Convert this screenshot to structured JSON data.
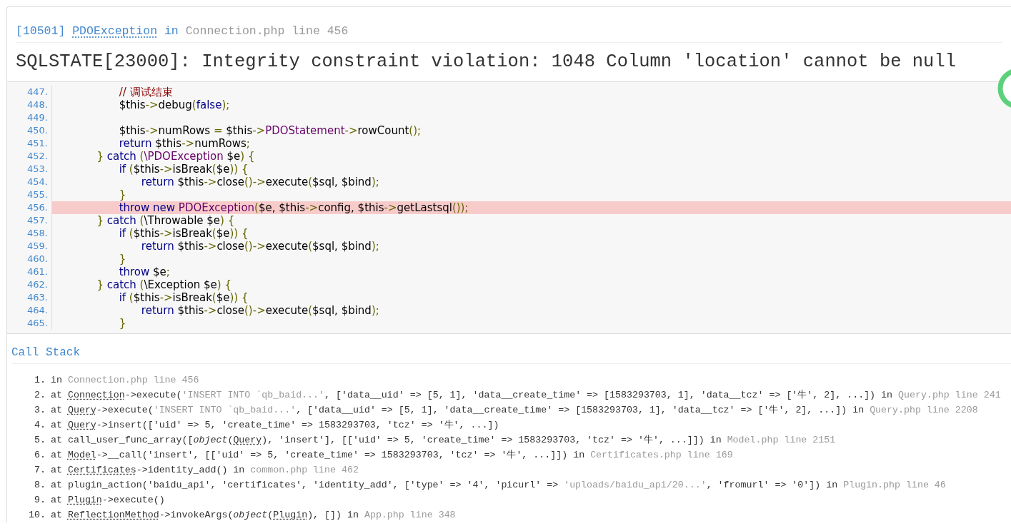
{
  "exception": {
    "code": "[10501]",
    "name": "PDOException",
    "in": "in",
    "location": "Connection.php line 456"
  },
  "message": "SQLSTATE[23000]: Integrity constraint violation: 1048 Column 'location' cannot be null",
  "code": {
    "lines": [
      {
        "number": "447.",
        "highlighted": false,
        "tokens": [
          {
            "kind": "com",
            "t": "            // 调试结束"
          }
        ]
      },
      {
        "number": "448.",
        "highlighted": false,
        "tokens": [
          {
            "kind": "pln",
            "t": "            $this"
          },
          {
            "kind": "pun",
            "t": "->"
          },
          {
            "kind": "pln",
            "t": "debug"
          },
          {
            "kind": "pun",
            "t": "("
          },
          {
            "kind": "kw",
            "t": "false"
          },
          {
            "kind": "pun",
            "t": ");"
          }
        ]
      },
      {
        "number": "449.",
        "highlighted": false
      },
      {
        "number": "450.",
        "highlighted": false,
        "tokens": [
          {
            "kind": "pln",
            "t": "            $this"
          },
          {
            "kind": "pun",
            "t": "->"
          },
          {
            "kind": "pln",
            "t": "numRows "
          },
          {
            "kind": "pun",
            "t": "="
          },
          {
            "kind": "pln",
            "t": " $this"
          },
          {
            "kind": "pun",
            "t": "->"
          },
          {
            "kind": "typ",
            "t": "PDOStatement"
          },
          {
            "kind": "pun",
            "t": "->"
          },
          {
            "kind": "pln",
            "t": "rowCount"
          },
          {
            "kind": "pun",
            "t": "();"
          }
        ]
      },
      {
        "number": "451.",
        "highlighted": false,
        "tokens": [
          {
            "kind": "kw",
            "t": "            return"
          },
          {
            "kind": "pln",
            "t": " $this"
          },
          {
            "kind": "pun",
            "t": "->"
          },
          {
            "kind": "pln",
            "t": "numRows"
          },
          {
            "kind": "pun",
            "t": ";"
          }
        ]
      },
      {
        "number": "452.",
        "highlighted": false,
        "tokens": [
          {
            "kind": "pun",
            "t": "        }"
          },
          {
            "kind": "kw",
            "t": " catch"
          },
          {
            "kind": "pun",
            "t": " ("
          },
          {
            "kind": "typ",
            "t": "\\PDOException"
          },
          {
            "kind": "pln",
            "t": " $e"
          },
          {
            "kind": "pun",
            "t": ") {"
          }
        ]
      },
      {
        "number": "453.",
        "highlighted": false,
        "tokens": [
          {
            "kind": "kw",
            "t": "            if"
          },
          {
            "kind": "pun",
            "t": " ("
          },
          {
            "kind": "pln",
            "t": "$this"
          },
          {
            "kind": "pun",
            "t": "->"
          },
          {
            "kind": "pln",
            "t": "isBreak"
          },
          {
            "kind": "pun",
            "t": "("
          },
          {
            "kind": "pln",
            "t": "$e"
          },
          {
            "kind": "pun",
            "t": ")) {"
          }
        ]
      },
      {
        "number": "454.",
        "highlighted": false,
        "tokens": [
          {
            "kind": "kw",
            "t": "                return"
          },
          {
            "kind": "pln",
            "t": " $this"
          },
          {
            "kind": "pun",
            "t": "->"
          },
          {
            "kind": "pln",
            "t": "close"
          },
          {
            "kind": "pun",
            "t": "()->"
          },
          {
            "kind": "pln",
            "t": "execute"
          },
          {
            "kind": "pun",
            "t": "("
          },
          {
            "kind": "pln",
            "t": "$sql, $bind"
          },
          {
            "kind": "pun",
            "t": ");"
          }
        ]
      },
      {
        "number": "455.",
        "highlighted": false,
        "tokens": [
          {
            "kind": "pun",
            "t": "            }"
          }
        ]
      },
      {
        "number": "456.",
        "highlighted": true,
        "tokens": [
          {
            "kind": "kw",
            "t": "            throw new"
          },
          {
            "kind": "typ",
            "t": " PDOException"
          },
          {
            "kind": "pun",
            "t": "("
          },
          {
            "kind": "pln",
            "t": "$e, $this"
          },
          {
            "kind": "pun",
            "t": "->"
          },
          {
            "kind": "pln",
            "t": "config, $this"
          },
          {
            "kind": "pun",
            "t": "->"
          },
          {
            "kind": "pln",
            "t": "getLastsql"
          },
          {
            "kind": "pun",
            "t": "());"
          }
        ]
      },
      {
        "number": "457.",
        "highlighted": false,
        "tokens": [
          {
            "kind": "pun",
            "t": "        }"
          },
          {
            "kind": "kw",
            "t": " catch"
          },
          {
            "kind": "pun",
            "t": " ("
          },
          {
            "kind": "pln",
            "t": "\\Throwable $e"
          },
          {
            "kind": "pun",
            "t": ") {"
          }
        ]
      },
      {
        "number": "458.",
        "highlighted": false,
        "tokens": [
          {
            "kind": "kw",
            "t": "            if"
          },
          {
            "kind": "pun",
            "t": " ("
          },
          {
            "kind": "pln",
            "t": "$this"
          },
          {
            "kind": "pun",
            "t": "->"
          },
          {
            "kind": "pln",
            "t": "isBreak"
          },
          {
            "kind": "pun",
            "t": "("
          },
          {
            "kind": "pln",
            "t": "$e"
          },
          {
            "kind": "pun",
            "t": ")) {"
          }
        ]
      },
      {
        "number": "459.",
        "highlighted": false,
        "tokens": [
          {
            "kind": "kw",
            "t": "                return"
          },
          {
            "kind": "pln",
            "t": " $this"
          },
          {
            "kind": "pun",
            "t": "->"
          },
          {
            "kind": "pln",
            "t": "close"
          },
          {
            "kind": "pun",
            "t": "()->"
          },
          {
            "kind": "pln",
            "t": "execute"
          },
          {
            "kind": "pun",
            "t": "("
          },
          {
            "kind": "pln",
            "t": "$sql, $bind"
          },
          {
            "kind": "pun",
            "t": ");"
          }
        ]
      },
      {
        "number": "460.",
        "highlighted": false,
        "tokens": [
          {
            "kind": "pun",
            "t": "            }"
          }
        ]
      },
      {
        "number": "461.",
        "highlighted": false,
        "tokens": [
          {
            "kind": "kw",
            "t": "            throw"
          },
          {
            "kind": "pln",
            "t": " $e"
          },
          {
            "kind": "pun",
            "t": ";"
          }
        ]
      },
      {
        "number": "462.",
        "highlighted": false,
        "tokens": [
          {
            "kind": "pun",
            "t": "        }"
          },
          {
            "kind": "kw",
            "t": " catch"
          },
          {
            "kind": "pun",
            "t": " ("
          },
          {
            "kind": "pln",
            "t": "\\Exception $e"
          },
          {
            "kind": "pun",
            "t": ") {"
          }
        ]
      },
      {
        "number": "463.",
        "highlighted": false,
        "tokens": [
          {
            "kind": "kw",
            "t": "            if"
          },
          {
            "kind": "pun",
            "t": " ("
          },
          {
            "kind": "pln",
            "t": "$this"
          },
          {
            "kind": "pun",
            "t": "->"
          },
          {
            "kind": "pln",
            "t": "isBreak"
          },
          {
            "kind": "pun",
            "t": "("
          },
          {
            "kind": "pln",
            "t": "$e"
          },
          {
            "kind": "pun",
            "t": ")) {"
          }
        ]
      },
      {
        "number": "464.",
        "highlighted": false,
        "tokens": [
          {
            "kind": "kw",
            "t": "                return"
          },
          {
            "kind": "pln",
            "t": " $this"
          },
          {
            "kind": "pun",
            "t": "->"
          },
          {
            "kind": "pln",
            "t": "close"
          },
          {
            "kind": "pun",
            "t": "()->"
          },
          {
            "kind": "pln",
            "t": "execute"
          },
          {
            "kind": "pun",
            "t": "("
          },
          {
            "kind": "pln",
            "t": "$sql, $bind"
          },
          {
            "kind": "pun",
            "t": ");"
          }
        ]
      },
      {
        "number": "465.",
        "highlighted": false,
        "tokens": [
          {
            "kind": "pun",
            "t": "            }"
          }
        ]
      }
    ]
  },
  "call_stack": {
    "title": "Call Stack",
    "entries": [
      {
        "number": "1.",
        "parts": [
          {
            "kind": "plain",
            "t": "in "
          },
          {
            "kind": "muted",
            "t": "Connection.php line 456"
          }
        ]
      },
      {
        "number": "2.",
        "parts": [
          {
            "kind": "plain",
            "t": "at "
          },
          {
            "kind": "class",
            "t": "Connection"
          },
          {
            "kind": "plain",
            "t": "->execute("
          },
          {
            "kind": "muted",
            "t": "'INSERT INTO `qb_baid...'"
          },
          {
            "kind": "plain",
            "t": ", ['data__uid' => [5, 1], 'data__create_time' => [1583293703, 1], 'data__tcz' => ['牛', 2], ...]) in "
          },
          {
            "kind": "muted",
            "t": "Query.php line 241"
          }
        ]
      },
      {
        "number": "3.",
        "parts": [
          {
            "kind": "plain",
            "t": "at "
          },
          {
            "kind": "class",
            "t": "Query"
          },
          {
            "kind": "plain",
            "t": "->execute("
          },
          {
            "kind": "muted",
            "t": "'INSERT INTO `qb_baid...'"
          },
          {
            "kind": "plain",
            "t": ", ['data__uid' => [5, 1], 'data__create_time' => [1583293703, 1], 'data__tcz' => ['牛', 2], ...]) in "
          },
          {
            "kind": "muted",
            "t": "Query.php line 2208"
          }
        ]
      },
      {
        "number": "4.",
        "parts": [
          {
            "kind": "plain",
            "t": "at "
          },
          {
            "kind": "class",
            "t": "Query"
          },
          {
            "kind": "plain",
            "t": "->insert(['uid' => 5, 'create_time' => 1583293703, 'tcz' => '牛', ...])"
          }
        ]
      },
      {
        "number": "5.",
        "parts": [
          {
            "kind": "plain",
            "t": "at call_user_func_array(["
          },
          {
            "kind": "italic",
            "t": "object"
          },
          {
            "kind": "plain",
            "t": "("
          },
          {
            "kind": "class",
            "t": "Query"
          },
          {
            "kind": "plain",
            "t": "), 'insert'], [['uid' => 5, 'create_time' => 1583293703, 'tcz' => '牛', ...]]) in "
          },
          {
            "kind": "muted",
            "t": "Model.php line 2151"
          }
        ]
      },
      {
        "number": "6.",
        "parts": [
          {
            "kind": "plain",
            "t": "at "
          },
          {
            "kind": "class",
            "t": "Model"
          },
          {
            "kind": "plain",
            "t": "->__call('insert', [['uid' => 5, 'create_time' => 1583293703, 'tcz' => '牛', ...]]) in "
          },
          {
            "kind": "muted",
            "t": "Certificates.php line 169"
          }
        ]
      },
      {
        "number": "7.",
        "parts": [
          {
            "kind": "plain",
            "t": "at "
          },
          {
            "kind": "class",
            "t": "Certificates"
          },
          {
            "kind": "plain",
            "t": "->identity_add() in "
          },
          {
            "kind": "muted",
            "t": "common.php line 462"
          }
        ]
      },
      {
        "number": "8.",
        "parts": [
          {
            "kind": "plain",
            "t": "at plugin_action('baidu_api', 'certificates', 'identity_add', ['type' => '4', 'picurl' => "
          },
          {
            "kind": "muted",
            "t": "'uploads/baidu_api/20...'"
          },
          {
            "kind": "plain",
            "t": ", 'fromurl' => '0']) in "
          },
          {
            "kind": "muted",
            "t": "Plugin.php line 46"
          }
        ]
      },
      {
        "number": "9.",
        "parts": [
          {
            "kind": "plain",
            "t": "at "
          },
          {
            "kind": "class",
            "t": "Plugin"
          },
          {
            "kind": "plain",
            "t": "->execute()"
          }
        ]
      },
      {
        "number": "10.",
        "parts": [
          {
            "kind": "plain",
            "t": "at "
          },
          {
            "kind": "class",
            "t": "ReflectionMethod"
          },
          {
            "kind": "plain",
            "t": "->invokeArgs("
          },
          {
            "kind": "italic",
            "t": "object"
          },
          {
            "kind": "plain",
            "t": "("
          },
          {
            "kind": "class",
            "t": "Plugin"
          },
          {
            "kind": "plain",
            "t": "), []) in "
          },
          {
            "kind": "muted",
            "t": "App.php line 348"
          }
        ]
      }
    ]
  }
}
